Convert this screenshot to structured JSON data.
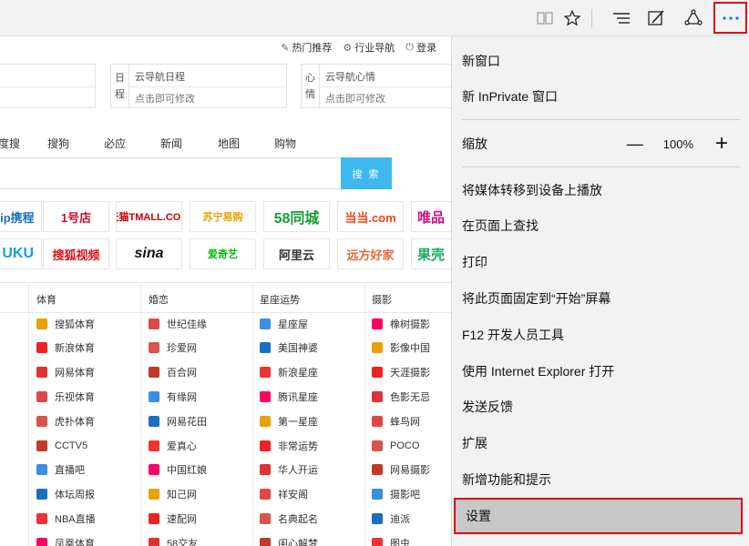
{
  "toolbar": {
    "icons": [
      "reading-view-icon",
      "favorite-star-icon",
      "hub-icon",
      "web-note-icon",
      "share-icon",
      "more-icon"
    ]
  },
  "page": {
    "toplinks": [
      "热门推荐",
      "行业导航",
      "登录"
    ],
    "box_schedule": {
      "side": [
        "日",
        "程"
      ],
      "title": "云导航日程",
      "hint": "点击即可修改"
    },
    "box_mood": {
      "side": [
        "心",
        "情"
      ],
      "title": "云导航心情",
      "hint": "点击即可修改"
    },
    "search_tabs": [
      "度搜",
      "搜狗",
      "必应",
      "新闻",
      "地图",
      "购物"
    ],
    "search_button": "搜 索",
    "logos_row1": [
      "Ctrip携程",
      "1号店",
      "天猫TMALL.COM",
      "苏宁易购",
      "58同城",
      "当当.com",
      "唯品"
    ],
    "logos_row2": [
      "UKU",
      "搜狐视频",
      "sina",
      "爱奇艺",
      "阿里云",
      "远方好家",
      "果壳"
    ],
    "categories": [
      "体育",
      "婚恋",
      "星座运势",
      "摄影"
    ],
    "col_sports": [
      "搜狐体育",
      "新浪体育",
      "网易体育",
      "乐视体育",
      "虎扑体育",
      "CCTV5",
      "直播吧",
      "体坛周报",
      "NBA直播",
      "凤凰体育"
    ],
    "col_love": [
      "世纪佳缘",
      "珍爱网",
      "百合网",
      "有缘网",
      "网易花田",
      "爱真心",
      "中国红娘",
      "知己网",
      "速配网",
      "58交友"
    ],
    "col_stars": [
      "星座屋",
      "美国神婆",
      "新浪星座",
      "腾讯星座",
      "第一星座",
      "非常运势",
      "华人开运",
      "祥安阁",
      "名典起名",
      "闺心解梦"
    ],
    "col_photo": [
      "橡树摄影",
      "影像中国",
      "天涯摄影",
      "色影无忌",
      "蜂鸟网",
      "POCO",
      "网易摄影",
      "摄影吧",
      "迪派",
      "图虫"
    ]
  },
  "menu": {
    "new_window": "新窗口",
    "new_inprivate": "新 InPrivate 窗口",
    "zoom_label": "缩放",
    "zoom_minus": "—",
    "zoom_value": "100%",
    "zoom_plus": "+",
    "cast": "将媒体转移到设备上播放",
    "find": "在页面上查找",
    "print": "打印",
    "pin": "将此页面固定到“开始”屏幕",
    "f12": "F12 开发人员工具",
    "open_ie": "使用 Internet Explorer 打开",
    "feedback": "发送反馈",
    "extensions": "扩展",
    "whats_new": "新增功能和提示",
    "settings": "设置"
  }
}
